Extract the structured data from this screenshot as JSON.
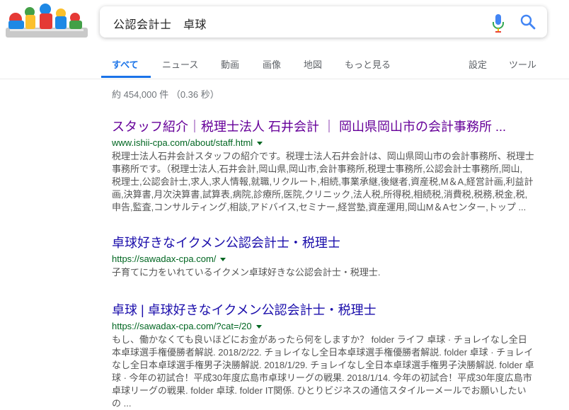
{
  "search": {
    "query": "公認会計士　卓球",
    "logo_alt": "Google Doodle"
  },
  "tabs": {
    "items": [
      "すべて",
      "ニュース",
      "動画",
      "画像",
      "地図",
      "もっと見る"
    ],
    "settings": "設定",
    "tools": "ツール"
  },
  "stats": "約 454,000 件 （0.36 秒）",
  "results": [
    {
      "title": "スタッフ紹介｜税理士法人 石井会計 ｜ 岡山県岡山市の会計事務所 ...",
      "url": "www.ishii-cpa.com/about/staff.html",
      "snippet_lines": [
        "税理士法人石井会計スタッフの紹介です。税理士法人石井会計は、岡山県岡山市の会計事務所、税理士",
        "事務所です。（税理士法人,石井会計,岡山県,岡山市,会計事務所,税理士事務所,公認会計士事務所,岡山,",
        "税理士,公認会計士,求人,求人情報,就職,リクルート,相続,事業承継,後継者,資産税,M＆A,経営計画,利益計",
        "画,決算書,月次決算書,試算表,病院,診療所,医院,クリニック,法人税,所得税,相続税,消費税,税務,税金,税,",
        "申告,監査,コンサルティング,相談,アドバイス,セミナー,経営塾,資産運用,岡山M＆Aセンター,トップ ..."
      ]
    },
    {
      "title": "卓球好きなイクメン公認会計士・税理士",
      "url": "https://sawadax-cpa.com/",
      "snippet_lines": [
        "子育てに力をいれているイクメン卓球好きな公認会計士・税理士."
      ]
    },
    {
      "title": "卓球 | 卓球好きなイクメン公認会計士・税理士",
      "url": "https://sawadax-cpa.com/?cat=/20",
      "snippet_lines": [
        "もし、働かなくても良いほどにお金があったら何をしますか？ folder ライフ 卓球 · チョレイなし全日",
        "本卓球選手権優勝者解説. 2018/2/22. チョレイなし全日本卓球選手権優勝者解説. folder 卓球 · チョレイ",
        "なし全日本卓球選手権男子決勝解説. 2018/1/29. チョレイなし全日本卓球選手権男子決勝解説. folder 卓",
        "球 · 今年の初試合！平成30年度広島市卓球リーグの戦果. 2018/1/14. 今年の初試合！平成30年度広島市",
        "卓球リーグの戦果. folder 卓球. folder IT関係. ひとりビジネスの通信スタイルーメールでお願いしたい",
        "の ..."
      ]
    }
  ],
  "colors": {
    "link_visited": "#660099",
    "link": "#1a0dab",
    "url_green": "#006621",
    "tab_active": "#1a73e8"
  }
}
